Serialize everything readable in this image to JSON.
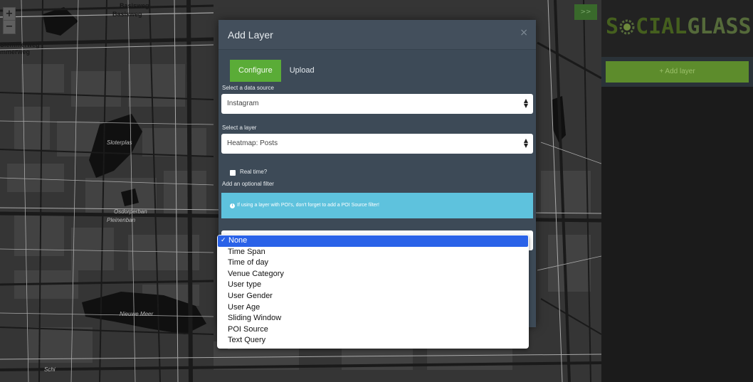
{
  "map": {
    "zoom_in": "+",
    "zoom_out": "−",
    "labels": [
      "Basisweg",
      "Basisweg",
      "Slemmerweg",
      "mmerweg",
      "Sloterplas",
      "Osdorperban",
      "Pleinenban",
      "Nieuwe Meer",
      "Schi"
    ]
  },
  "sidebar": {
    "toggle_label": ">>",
    "brand_part1": "S",
    "brand_icon": "gear-globe-icon",
    "brand_part2": "CIAL",
    "brand_part3": "GLASS",
    "add_layer_label": "+ Add layer"
  },
  "modal": {
    "title": "Add Layer",
    "close_label": "×",
    "tabs": [
      {
        "label": "Configure",
        "active": true
      },
      {
        "label": "Upload",
        "active": false
      }
    ],
    "source_label": "Select a data source",
    "source_value": "Instagram",
    "layer_label": "Select a layer",
    "layer_value": "Heatmap: Posts",
    "realtime_label": "Real time?",
    "filter_label": "Add an optional filter",
    "info_text": "If using a layer with POI's, don't forget to add a POI Source filter!",
    "select_arrows": "▲▼"
  },
  "dropdown": {
    "options": [
      {
        "label": "None",
        "selected": true
      },
      {
        "label": "Time Span",
        "selected": false
      },
      {
        "label": "Time of day",
        "selected": false
      },
      {
        "label": "Venue Category",
        "selected": false
      },
      {
        "label": "User type",
        "selected": false
      },
      {
        "label": "User Gender",
        "selected": false
      },
      {
        "label": "User Age",
        "selected": false
      },
      {
        "label": "Sliding Window",
        "selected": false
      },
      {
        "label": "POI Source",
        "selected": false
      },
      {
        "label": "Text Query",
        "selected": false
      }
    ],
    "check_mark": "✓"
  },
  "colors": {
    "accent_green": "#5aac37",
    "info_blue": "#5ec2dd",
    "selected_blue": "#2a62e8",
    "modal_bg": "#3d4a57"
  }
}
